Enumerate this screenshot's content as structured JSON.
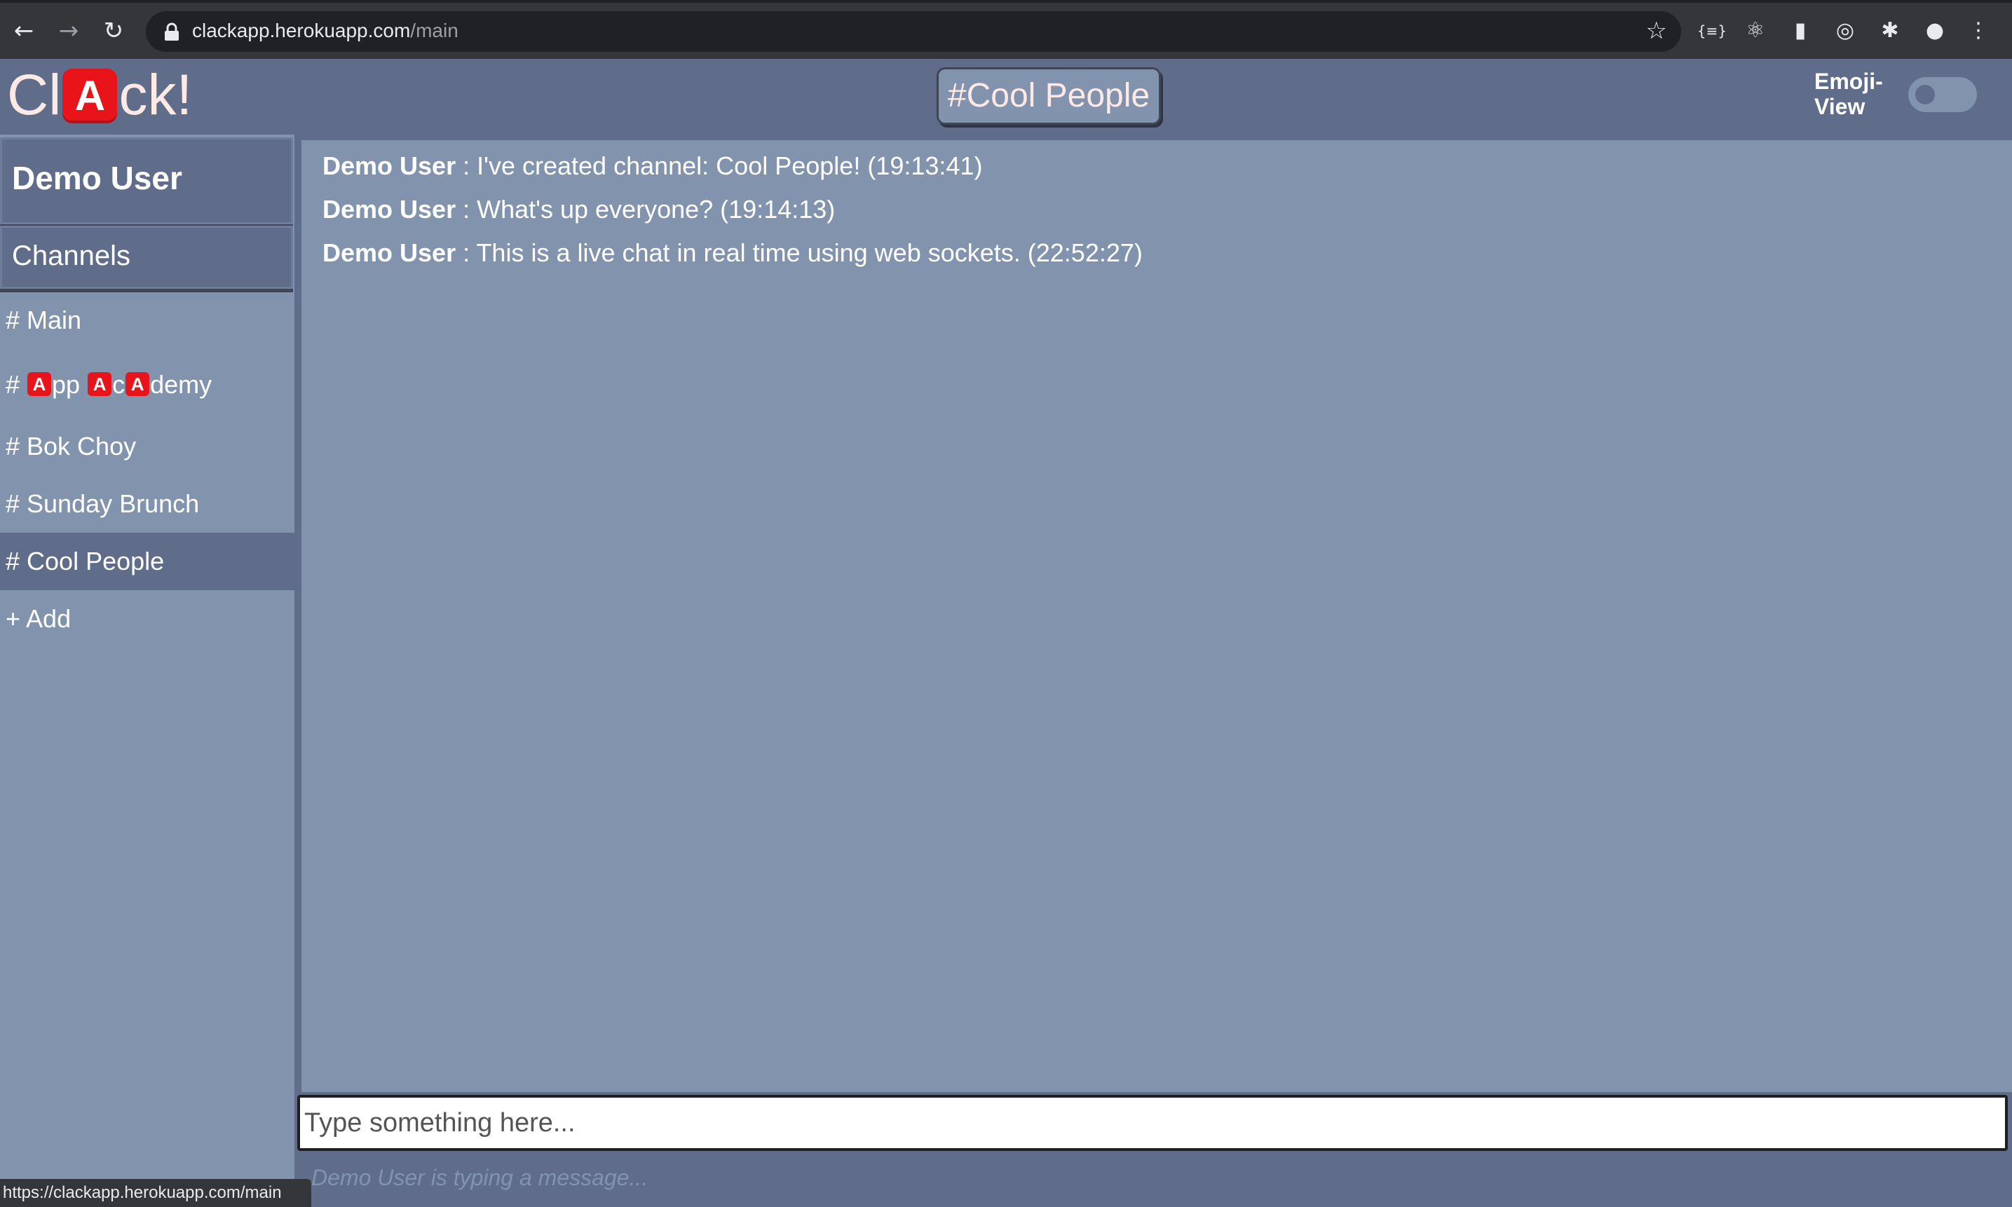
{
  "browser": {
    "url_host": "clackapp.herokuapp.com",
    "url_path": "/main",
    "status_url": "https://clackapp.herokuapp.com/main"
  },
  "header": {
    "logo_pre": "Cl",
    "logo_badge": "A",
    "logo_post": "ck!",
    "channel_title": "#Cool People",
    "emoji_toggle_label_1": "Emoji-",
    "emoji_toggle_label_2": "View",
    "emoji_view_on": false
  },
  "sidebar": {
    "user_name": "Demo User",
    "channels_label": "Channels",
    "items": [
      {
        "label": "# Main",
        "active": false
      },
      {
        "prefix": "# ",
        "parts": [
          "A",
          "pp ",
          "A",
          "c",
          "A",
          "demy"
        ],
        "active": false
      },
      {
        "label": "# Bok Choy",
        "active": false
      },
      {
        "label": "# Sunday Brunch",
        "active": false
      },
      {
        "label": "# Cool People",
        "active": true
      }
    ],
    "add_label": "+ Add"
  },
  "chat": {
    "messages": [
      {
        "author": "Demo User",
        "separator": " : ",
        "text": "I've created channel: Cool People! (19:13:41)"
      },
      {
        "author": "Demo User",
        "separator": " : ",
        "text": "What's up everyone? (19:14:13)"
      },
      {
        "author": "Demo User",
        "separator": " : ",
        "text": "This is a live chat in real time using web sockets. (22:52:27)"
      }
    ],
    "input_placeholder": "Type something here...",
    "input_value": "",
    "typing_indicator": "Demo User is typing a message..."
  },
  "colors": {
    "app_bg": "#8294ad",
    "header_bg": "#5f6d8b",
    "accent_red": "#e8141a"
  }
}
